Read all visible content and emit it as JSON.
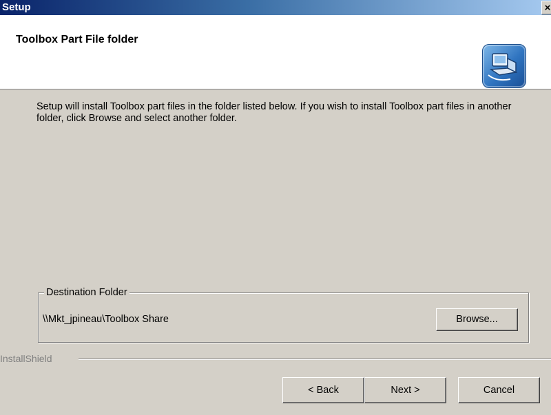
{
  "window": {
    "title": "Setup",
    "close_label": "×"
  },
  "header": {
    "title": "Toolbox Part File folder",
    "icon": "installer-computer-icon"
  },
  "description": "Setup will install Toolbox part files in the folder listed below. If you wish to install Toolbox part files in another folder, click Browse and select another folder.",
  "destination": {
    "legend": "Destination Folder",
    "path": "\\\\Mkt_jpineau\\Toolbox Share",
    "browse_label": "Browse..."
  },
  "brand": "InstallShield",
  "buttons": {
    "back": "< Back",
    "next": "Next >",
    "cancel": "Cancel"
  }
}
